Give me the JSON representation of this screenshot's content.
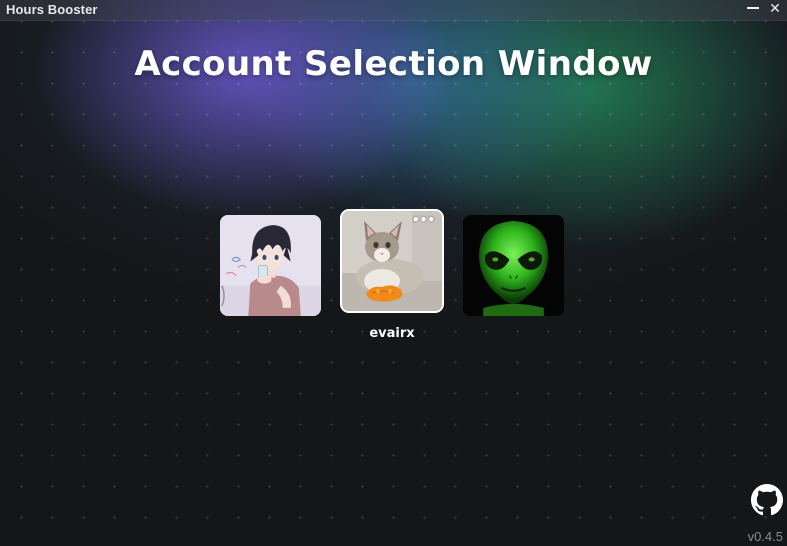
{
  "window": {
    "title": "Hours Booster",
    "minimize_icon": "minimize-icon",
    "close_icon": "close-icon",
    "close_glyph": "✕"
  },
  "main": {
    "heading": "Account Selection Window"
  },
  "accounts": [
    {
      "avatar": "anime-boy-drinking-avatar",
      "name": "",
      "selected": false
    },
    {
      "avatar": "cat-with-orange-toy-avatar",
      "name": "evairx",
      "selected": true,
      "menu_glyph": "•••"
    },
    {
      "avatar": "green-alien-avatar",
      "name": "",
      "selected": false
    }
  ],
  "footer": {
    "github_icon": "github-icon",
    "version": "v0.4.5"
  },
  "colors": {
    "background": "#151618",
    "accent_purple": "#785fe6",
    "accent_green": "#28b46e",
    "text": "#ffffff",
    "muted": "#8c8c8e"
  }
}
